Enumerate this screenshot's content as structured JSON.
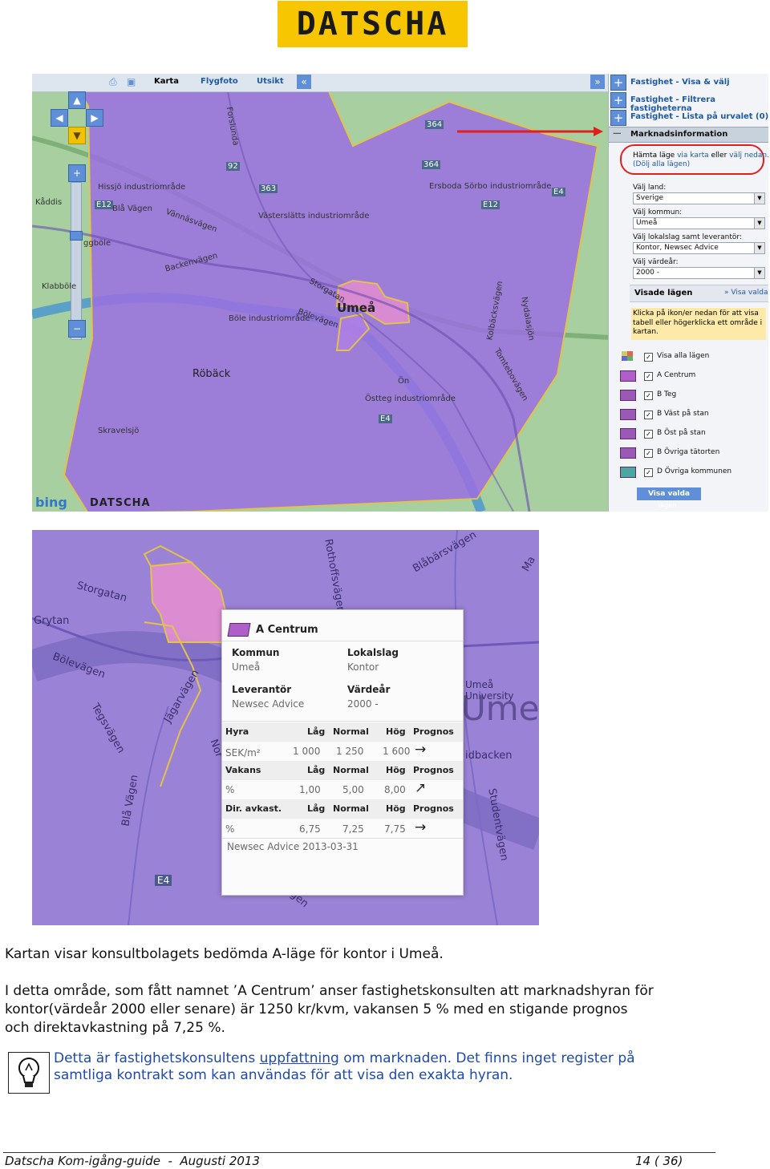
{
  "logo": {
    "text": "DATSCHA",
    "bg": "#f7c600"
  },
  "map1": {
    "toolbar": {
      "karta": "Karta",
      "flygfoto": "Flygfoto",
      "utsikt": "Utsikt"
    },
    "labels": {
      "hissjo": "Hissjö industriområde",
      "kaddis": "Kåddis",
      "ggbole": "ggböle",
      "klabbole": "Klabböle",
      "blavagen1": "Blå Vägen",
      "vannasvagen": "Vännäsvägen",
      "backenvagen": "Backenvägen",
      "vasterslatt": "Västerslätts industriområde",
      "ersboda": "Ersboda Sörbo industriområde",
      "umea": "Umeå",
      "storgatan": "Storgatan",
      "bole": "Böle industriområde",
      "bolevagen": "Bölevägen",
      "roback": "Röbäck",
      "skravelsjo": "Skravelsjö",
      "on": "Ön",
      "ostteg": "Östteg industriområde",
      "kolbacksvagen": "Kolbäcksvägen",
      "tomtebovagen": "Tomtebovägen",
      "nydalasjon": "Nydalasjön",
      "forslunda": "Forslunda",
      "e4": "E4",
      "e12": "E12",
      "r363": "363",
      "r364": "364",
      "r92": "92"
    },
    "bing": "bing",
    "datscha": "DATSCHA"
  },
  "panel": {
    "link1": "Fastighet - Visa & välj",
    "link2": "Fastighet - Filtrera fastigheterna",
    "link3": "Fastighet - Lista på urvalet (0)",
    "section": "Marknadsinformation",
    "hamta": "Hämta läge",
    "via_karta": "via karta",
    "eller": "eller",
    "valj_nedan": "välj nedan.",
    "dolj": "(Dölj alla lägen)",
    "land_label": "Välj land:",
    "land_value": "Sverige",
    "kommun_label": "Välj kommun:",
    "kommun_value": "Umeå",
    "lokalslag_label": "Välj lokalslag samt leverantör:",
    "lokalslag_value": "Kontor, Newsec Advice",
    "vardear_label": "Välj värdeår:",
    "vardear_value": "2000 -",
    "visade": "Visade lägen",
    "visa_valda_link": "Visa valda",
    "info": "Klicka på ikon/er nedan för att visa tabell eller högerklicka ett område i kartan.",
    "items": [
      {
        "label": "Visa alla lägen"
      },
      {
        "label": "A Centrum",
        "color": "#b05fc8"
      },
      {
        "label": "B Teg",
        "color": "#8a5fc8"
      },
      {
        "label": "B Väst på stan",
        "color": "#8a5fc8"
      },
      {
        "label": "B Öst på stan",
        "color": "#8a5fc8"
      },
      {
        "label": "B Övriga tätorten",
        "color": "#8a5fc8"
      },
      {
        "label": "D Övriga kommunen",
        "color": "#4aa8a0"
      }
    ],
    "visa_valda_btn": "Visa valda",
    "lagen": "lägen"
  },
  "map2": {
    "labels": {
      "storgatan": "Storgatan",
      "grytan": "Grytan",
      "bolevagen": "Bölevägen",
      "jagarvagen": "Jägarvägen",
      "tegsvagen": "Tegsvägen",
      "blavagen": "Blå Vägen",
      "rothoffsvagen": "Rothoffsvägen",
      "blabarsvagen": "Blåbärsvägen",
      "university": "Umeå University",
      "ume": "Ume",
      "idbacken": "idbacken",
      "studentvagen": "Studentvägen",
      "e4": "E4",
      "nor": "Nor",
      "ma": "Ma"
    }
  },
  "popup": {
    "title": "A Centrum",
    "kommun_h": "Kommun",
    "kommun_v": "Umeå",
    "lokalslag_h": "Lokalslag",
    "lokalslag_v": "Kontor",
    "leverantor_h": "Leverantör",
    "leverantor_v": "Newsec Advice",
    "vardear_h": "Värdeår",
    "vardear_v": "2000 -",
    "headers": [
      "Låg",
      "Normal",
      "Hög",
      "Prognos"
    ],
    "rows": [
      {
        "name": "Hyra",
        "unit": "SEK/m²",
        "values": [
          "1 000",
          "1 250",
          "1 600"
        ],
        "trend": "→"
      },
      {
        "name": "Vakans",
        "unit": "%",
        "values": [
          "1,00",
          "5,00",
          "8,00"
        ],
        "trend": "↗"
      },
      {
        "name": "Dir. avkast.",
        "unit": "%",
        "values": [
          "6,75",
          "7,25",
          "7,75"
        ],
        "trend": "→"
      }
    ],
    "source": "Newsec Advice 2013-03-31"
  },
  "text": {
    "caption": "Kartan visar konsultbolagets bedömda A-läge för kontor i Umeå.",
    "p1_l1": "I detta område, som fått namnet ’A Centrum’ anser fastighetskonsulten att marknadshyran för",
    "p1_l2": "kontor(värdeår 2000 eller senare) är 1250 kr/kvm, vakansen 5 % med en stigande prognos",
    "p1_l3": "och direktavkastning på 7,25 %.",
    "note_a": "Detta är fastighetskonsultens ",
    "note_u": "uppfattning",
    "note_b": " om marknaden. Det finns inget register på",
    "note_l2": "samtliga kontrakt som kan användas för att visa den exakta hyran."
  },
  "footer": {
    "left": "Datscha Kom-igång-guide  -  Augusti 2013",
    "right": "14 ( 36)"
  }
}
